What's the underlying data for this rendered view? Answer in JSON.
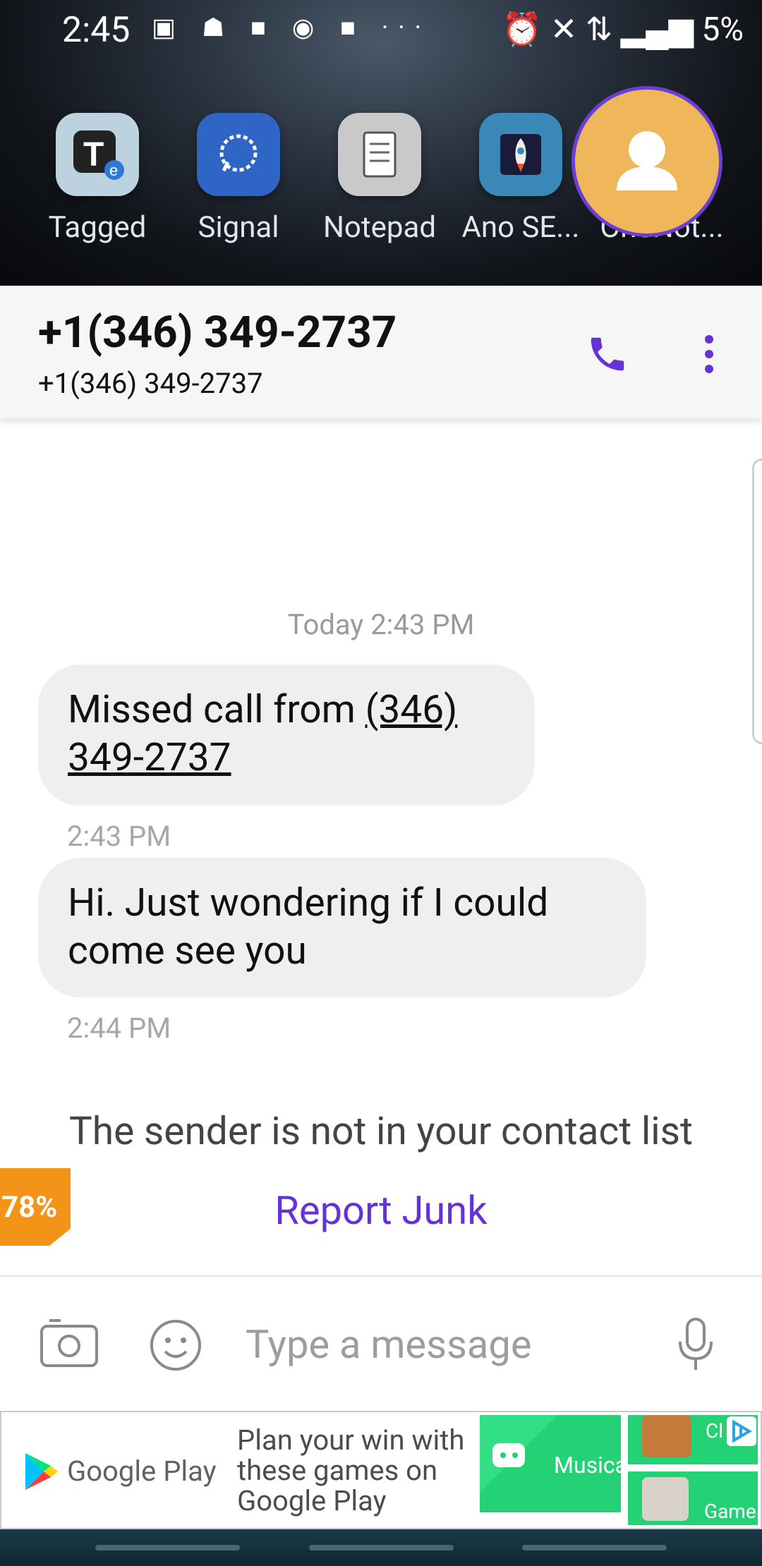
{
  "status_bar": {
    "time": "2:45",
    "notif_icons": "▣ ☗ ■ ◉ ■ ···",
    "right_text": "⏰ ✕ ⇅ ▂▄▆ 5%"
  },
  "dock": {
    "apps": [
      {
        "label": "Tagged",
        "icon": "tagged-app-icon"
      },
      {
        "label": "Signal",
        "icon": "signal-app-icon"
      },
      {
        "label": "Notepad",
        "icon": "notepad-app-icon"
      },
      {
        "label": "Ano SE...",
        "icon": "rocket-app-icon"
      },
      {
        "label": "OneNot...",
        "icon": "onenote-app-icon"
      }
    ]
  },
  "header": {
    "title": "+1(346) 349-2737",
    "subtitle": "+1(346) 349-2737",
    "accent": "#6432d6"
  },
  "conversation": {
    "date_separator": "Today 2:43 PM",
    "messages": [
      {
        "prefix": "Missed call from ",
        "link": "(346)",
        "link2": "349-2737",
        "time": "2:43 PM"
      },
      {
        "text": "Hi.  Just wondering if I could come see you",
        "time": "2:44 PM"
      }
    ],
    "notice": "The sender is not in your contact list",
    "report_junk": "Report Junk",
    "badge": "78%"
  },
  "composer": {
    "placeholder": "Type a message"
  },
  "ad": {
    "brand": "Google Play",
    "copy": "Plan your win with these games on Google Play",
    "tile_labels": [
      "Musica",
      "Cl",
      "Game"
    ]
  }
}
